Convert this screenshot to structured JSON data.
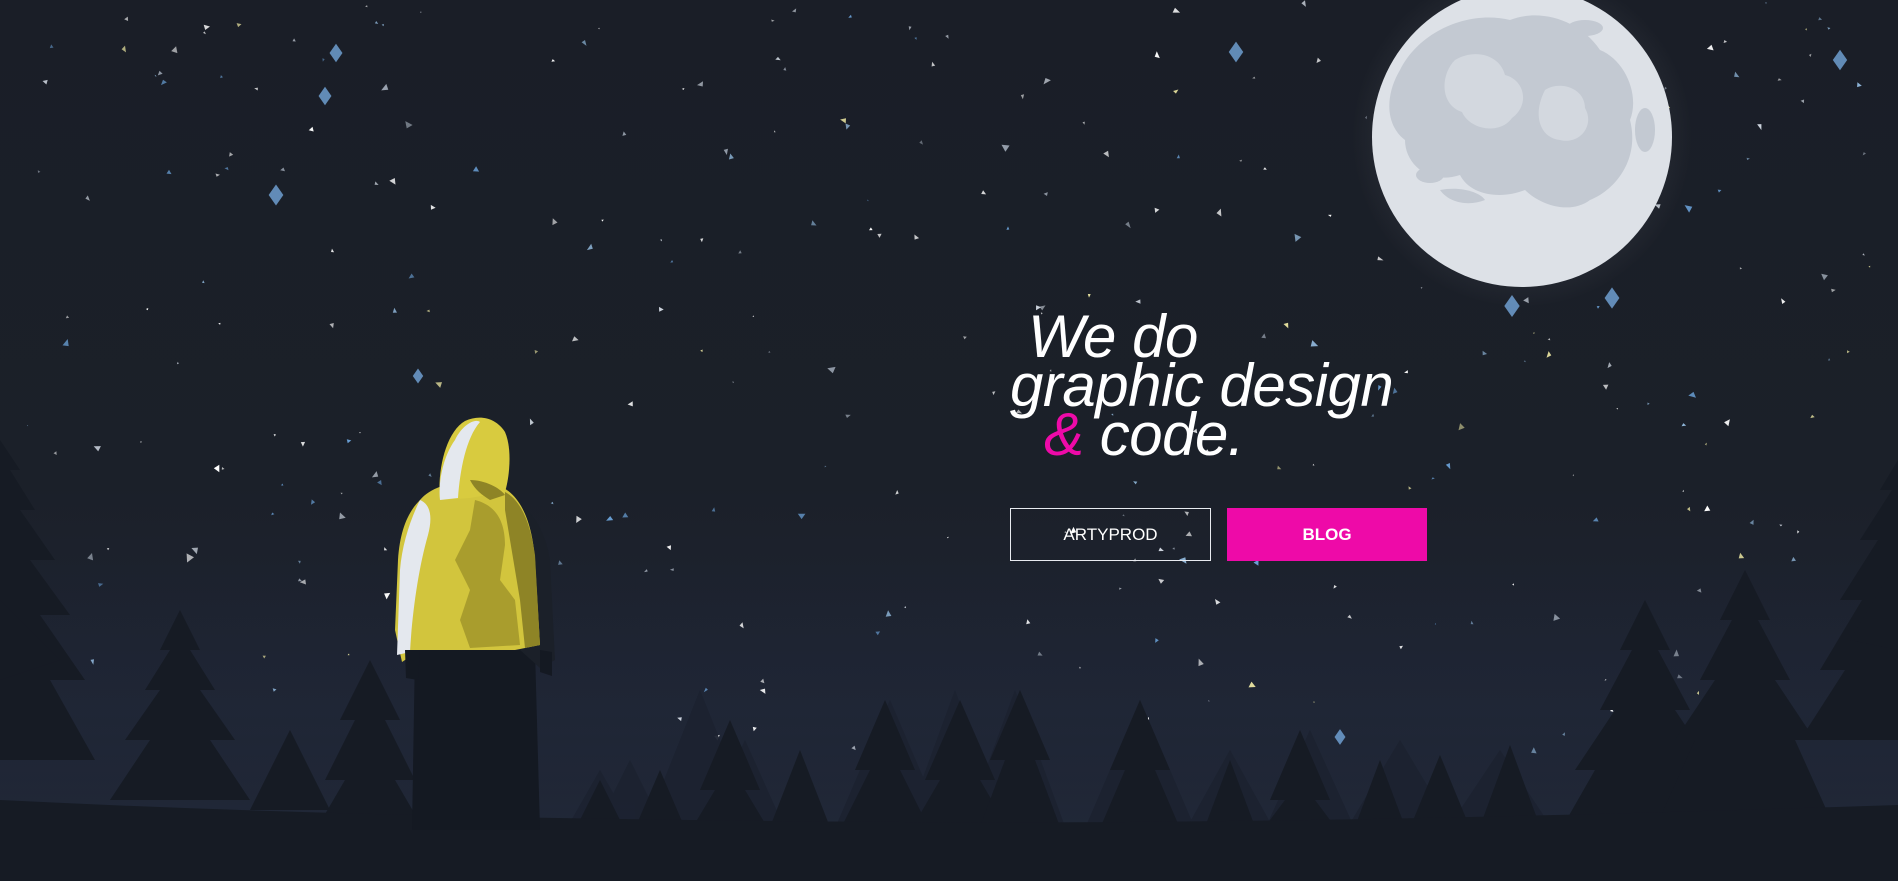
{
  "hero": {
    "line1": "We do",
    "line2": "graphic design",
    "ampersand": "&",
    "line3": "code."
  },
  "buttons": {
    "secondary_label": "ARTYPROD",
    "primary_label": "BLOG"
  },
  "colors": {
    "background": "#1a1e27",
    "accent": "#ee0aa8",
    "moon": "#dde1e7",
    "moon_craters": "#c2c8d1",
    "hoodie": "#d2c53d",
    "trees": "#161b24",
    "text": "#ffffff"
  },
  "illustration": {
    "moon": "full-moon",
    "figure": "hooded-person-yellow-jacket",
    "foreground": "pine-tree-silhouettes",
    "sky": "starry-night-confetti"
  }
}
